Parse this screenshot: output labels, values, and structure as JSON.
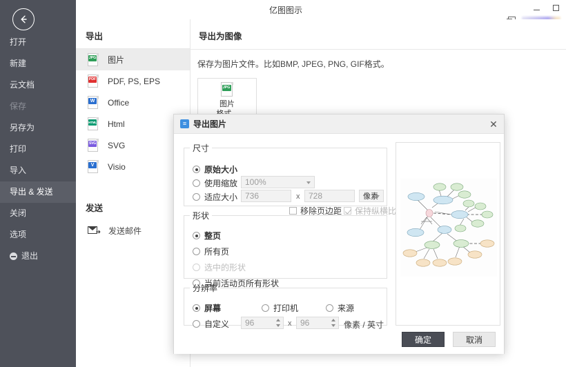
{
  "window": {
    "title": "亿图图示",
    "minimize": "–",
    "maximize": "□",
    "account_icon": "switch-account-icon"
  },
  "sidebar": {
    "back_icon": "back-arrow-icon",
    "items": [
      {
        "label": "打开",
        "state": "normal"
      },
      {
        "label": "新建",
        "state": "normal"
      },
      {
        "label": "云文档",
        "state": "normal"
      },
      {
        "label": "保存",
        "state": "disabled"
      },
      {
        "label": "另存为",
        "state": "normal"
      },
      {
        "label": "打印",
        "state": "normal"
      },
      {
        "label": "导入",
        "state": "normal"
      },
      {
        "label": "导出 & 发送",
        "state": "active"
      },
      {
        "label": "关闭",
        "state": "normal"
      },
      {
        "label": "选项",
        "state": "normal"
      },
      {
        "label": "退出",
        "state": "exit"
      }
    ]
  },
  "export_column": {
    "heading": "导出",
    "formats": [
      {
        "label": "图片",
        "tag": "JPG",
        "tag_color": "#2e9e58",
        "selected": true
      },
      {
        "label": "PDF, PS, EPS",
        "tag": "PDF",
        "tag_color": "#e03131",
        "selected": false
      },
      {
        "label": "Office",
        "tag": "W",
        "tag_color": "#2a6fd0",
        "selected": false
      },
      {
        "label": "Html",
        "tag": "HTML",
        "tag_color": "#0f9d74",
        "selected": false
      },
      {
        "label": "SVG",
        "tag": "SVG",
        "tag_color": "#7b5ce0",
        "selected": false
      },
      {
        "label": "Visio",
        "tag": "V",
        "tag_color": "#2a6fd0",
        "selected": false
      }
    ],
    "send_heading": "发送",
    "send_items": [
      {
        "label": "发送邮件",
        "icon": "mail-icon"
      }
    ]
  },
  "detail": {
    "title": "导出为图像",
    "description": "保存为图片文件。比如BMP, JPEG, PNG, GIF格式。",
    "card": {
      "tag": "JPG",
      "tag_color": "#2e9e58",
      "line1": "图片",
      "line2": "格式..."
    }
  },
  "dialog": {
    "icon": "export-image-icon",
    "icon_glyph": "≡",
    "title": "导出图片",
    "close_glyph": "✕",
    "size_group": {
      "legend": "尺寸",
      "original": {
        "label": "原始大小",
        "checked": true
      },
      "scale": {
        "label": "使用缩放",
        "checked": false,
        "value": "100%"
      },
      "fit": {
        "label": "适应大小",
        "checked": false,
        "width": "736",
        "height": "728",
        "unit": "像素"
      },
      "x_sep": "x",
      "remove_margin": {
        "label": "移除页边距",
        "checked": false
      },
      "keep_ratio": {
        "label": "保持纵横比",
        "checked": true,
        "disabled": true
      }
    },
    "shape_group": {
      "legend": "形状",
      "options": [
        {
          "label": "整页",
          "checked": true,
          "disabled": false
        },
        {
          "label": "所有页",
          "checked": false,
          "disabled": false
        },
        {
          "label": "选中的形状",
          "checked": false,
          "disabled": true
        },
        {
          "label": "当前活动页所有形状",
          "checked": false,
          "disabled": false
        }
      ]
    },
    "resolution_group": {
      "legend": "分辨率",
      "options": [
        {
          "label": "屏幕",
          "checked": true
        },
        {
          "label": "打印机",
          "checked": false
        },
        {
          "label": "来源",
          "checked": false
        }
      ],
      "custom": {
        "label": "自定义",
        "checked": false,
        "dpi_x": "96",
        "dpi_y": "96",
        "x_sep": "x",
        "unit": "像素 / 英寸"
      }
    },
    "preview": {
      "name": "export-preview"
    },
    "buttons": {
      "ok": "确定",
      "cancel": "取消"
    }
  }
}
